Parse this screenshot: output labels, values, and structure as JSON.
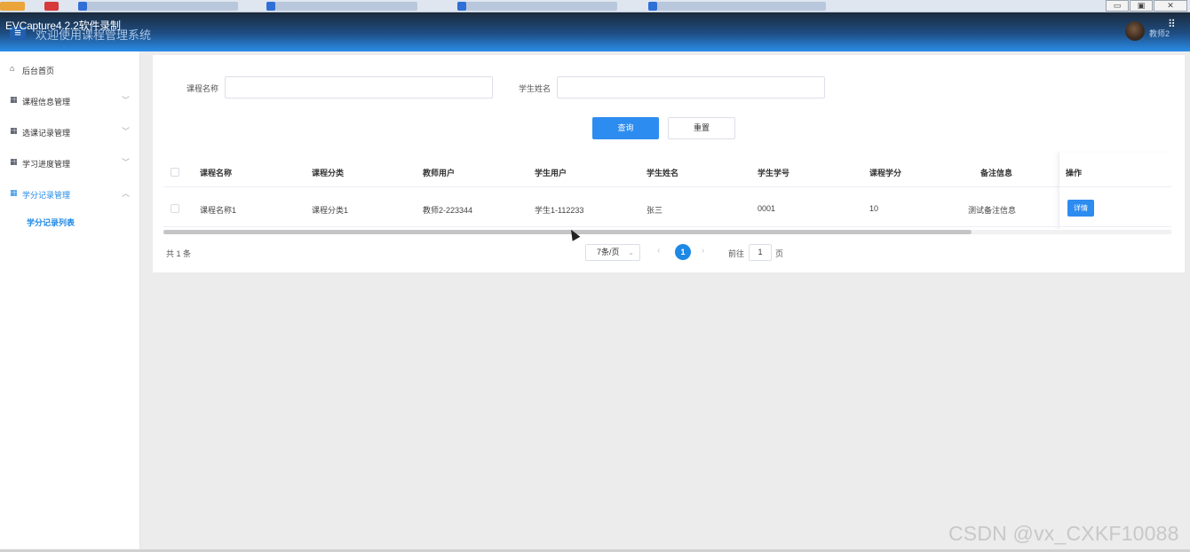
{
  "capture_label": "EVCapture4.2.2软件录制",
  "header": {
    "welcome": "欢迎使用课程管理系统",
    "menu_icon": "≡",
    "user_label": "教师2",
    "grid_icon": "⠿"
  },
  "sidebar": {
    "items": [
      {
        "label": "后台首页",
        "icon": "home-icon"
      },
      {
        "label": "课程信息管理",
        "icon": "grid-icon"
      },
      {
        "label": "选课记录管理",
        "icon": "grid-icon"
      },
      {
        "label": "学习进度管理",
        "icon": "grid-icon"
      },
      {
        "label": "学分记录管理",
        "icon": "grid-icon"
      }
    ],
    "sub_item": "学分记录列表"
  },
  "search": {
    "course_label": "课程名称",
    "course_value": "",
    "student_label": "学生姓名",
    "student_value": "",
    "query_button": "查询",
    "reset_button": "重置"
  },
  "table": {
    "headers": [
      "课程名称",
      "课程分类",
      "教师用户",
      "学生用户",
      "学生姓名",
      "学生学号",
      "课程学分",
      "备注信息",
      "操作"
    ],
    "rows": [
      [
        "课程名称1",
        "课程分类1",
        "教师2-223344",
        "学生1-112233",
        "张三",
        "0001",
        "10",
        "测试备注信息"
      ]
    ],
    "detail_button": "详情"
  },
  "pagination": {
    "total": "共 1 条",
    "page_size": "7条/页",
    "current_page": "1",
    "goto_label": "前往",
    "goto_value": "1",
    "page_word": "页"
  },
  "watermark": "CSDN @vx_CXKF10088",
  "colors": {
    "accent": "#2d8cf0",
    "header_top": "#1b2a3c",
    "header_bottom": "#2a8de8"
  }
}
